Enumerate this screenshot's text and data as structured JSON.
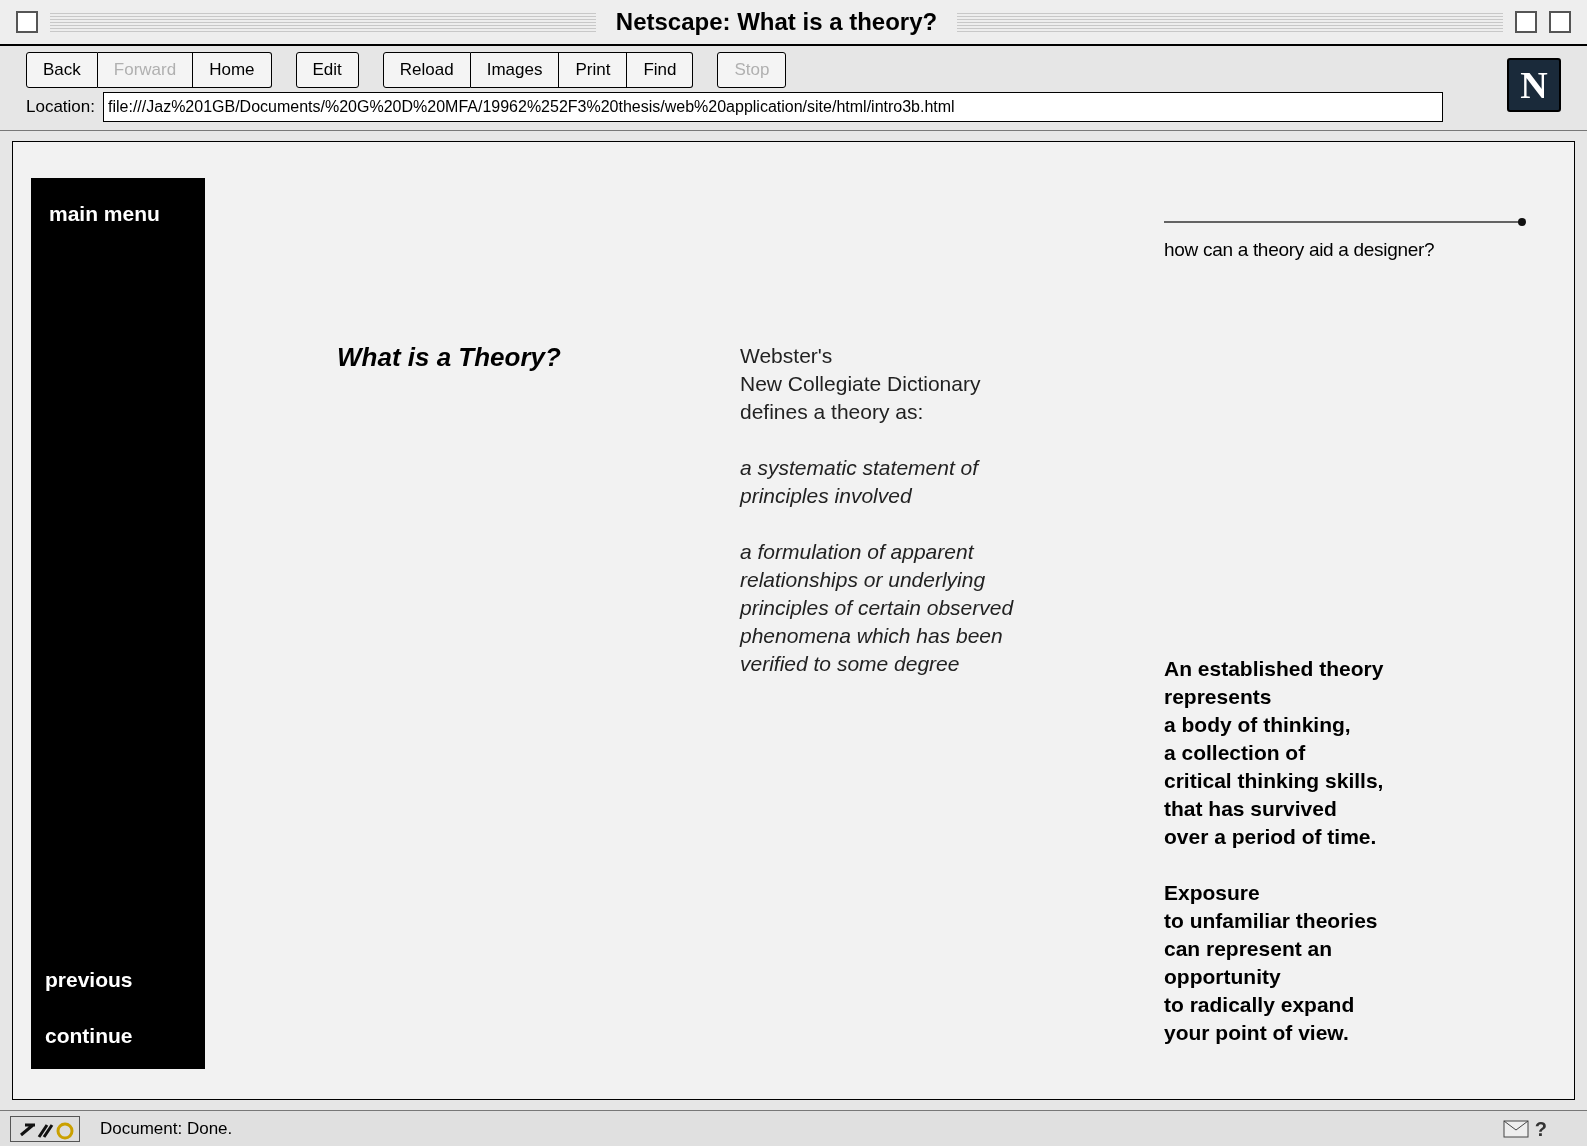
{
  "window": {
    "title": "Netscape: What is a theory?"
  },
  "toolbar": {
    "groups": [
      [
        {
          "label": "Back",
          "disabled": false
        },
        {
          "label": "Forward",
          "disabled": true
        },
        {
          "label": "Home",
          "disabled": false
        }
      ],
      [
        {
          "label": "Edit",
          "disabled": false
        }
      ],
      [
        {
          "label": "Reload",
          "disabled": false
        },
        {
          "label": "Images",
          "disabled": false
        },
        {
          "label": "Print",
          "disabled": false
        },
        {
          "label": "Find",
          "disabled": false
        }
      ],
      [
        {
          "label": "Stop",
          "disabled": true
        }
      ]
    ],
    "logo": "N"
  },
  "location": {
    "label": "Location:",
    "value": "file:///Jaz%201GB/Documents/%20G%20D%20MFA/19962%252F3%20thesis/web%20application/site/html/intro3b.html"
  },
  "page": {
    "sidebar": {
      "top": "main menu",
      "bottom": [
        "previous",
        "continue"
      ]
    },
    "heading": "What is a Theory?",
    "definition": {
      "intro": "Webster's\nNew Collegiate Dictionary\ndefines a theory as:",
      "meanings": [
        "a systematic statement of\nprinciples involved",
        "a formulation of apparent\nrelationships or underlying\nprinciples of certain observed\nphenomena which has been\nverified to some degree"
      ]
    },
    "aside": {
      "link": "how can a theory aid a designer?",
      "paragraphs": [
        "An established theory\nrepresents\na body of thinking,\na collection of\ncritical thinking skills,\nthat has survived\nover a period of time.",
        "Exposure\nto unfamiliar theories\ncan represent an\nopportunity\nto radically expand\nyour point of view."
      ]
    }
  },
  "status_bar": {
    "text": "Document: Done.",
    "help": "?"
  }
}
